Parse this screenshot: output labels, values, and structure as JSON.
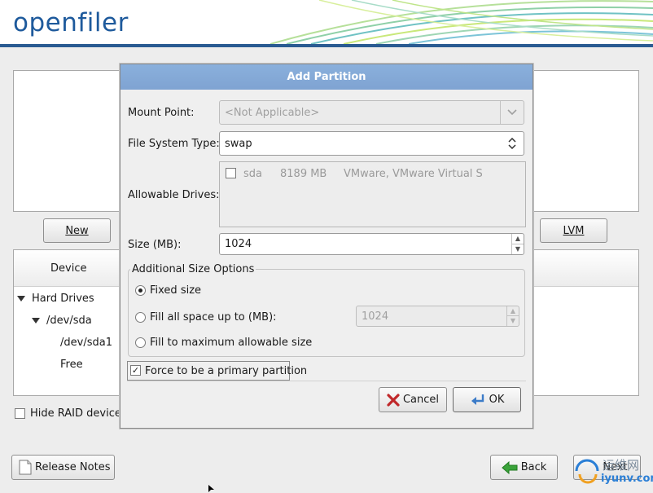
{
  "header": {
    "logo_text": "openfiler"
  },
  "main": {
    "new_label": "New",
    "lvm_label": "LVM",
    "tree_header_device": "Device",
    "tree": [
      {
        "label": "Hard Drives"
      },
      {
        "label": "/dev/sda"
      },
      {
        "label": "/dev/sda1"
      },
      {
        "label": "Free"
      }
    ],
    "hide_raid_label": "Hide RAID device/"
  },
  "footer": {
    "release_notes_label": "Release Notes",
    "back_label": "Back",
    "next_label": "Next",
    "watermark_cn": "运维网",
    "watermark_url": "iyunv.com"
  },
  "dialog": {
    "title": "Add Partition",
    "mount_point_label": "Mount Point:",
    "mount_point_value": "<Not Applicable>",
    "fs_type_label": "File System Type:",
    "fs_type_value": "swap",
    "allowable_drives_label": "Allowable Drives:",
    "drives": [
      {
        "name": "sda",
        "size": "8189 MB",
        "model": "VMware, VMware Virtual S",
        "checked": false
      }
    ],
    "size_label": "Size (MB):",
    "size_value": "1024",
    "additional_options_label": "Additional Size Options",
    "option_fixed": "Fixed size",
    "option_fill_upto": "Fill all space up to (MB):",
    "fill_upto_value": "1024",
    "option_fill_max": "Fill to maximum allowable size",
    "selected_option": "fixed",
    "primary_label": "Force to be a primary partition",
    "primary_checked": true,
    "cancel_label": "Cancel",
    "ok_label": "OK"
  },
  "colors": {
    "brand_blue": "#1e5a9c",
    "title_bar": "#8ab0dc",
    "cancel_red": "#c0282a"
  }
}
